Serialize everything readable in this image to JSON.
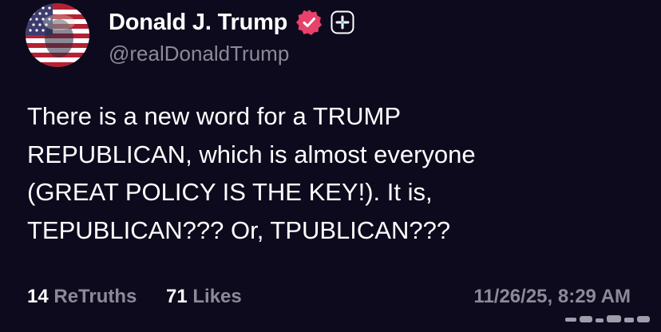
{
  "author": {
    "display_name": "Donald J. Trump",
    "handle": "@realDonaldTrump",
    "avatar_icon": "avatar-flag-portrait",
    "verified_icon": "verified-badge-icon",
    "plus_icon": "plus-badge-icon"
  },
  "post": {
    "lines": [
      "There is a new word for a TRUMP",
      "REPUBLICAN, which is almost everyone",
      "(GREAT POLICY IS THE KEY!). It is,",
      "TEPUBLICAN??? Or, TPUBLICAN???"
    ]
  },
  "footer": {
    "retruths_count": "14",
    "retruths_label": "ReTruths",
    "likes_count": "71",
    "likes_label": "Likes",
    "timestamp": "11/26/25, 8:29 AM"
  },
  "colors": {
    "background": "#0d0a1d",
    "text": "#ffffff",
    "muted": "#8b8a98",
    "verified": "#e8426a"
  }
}
